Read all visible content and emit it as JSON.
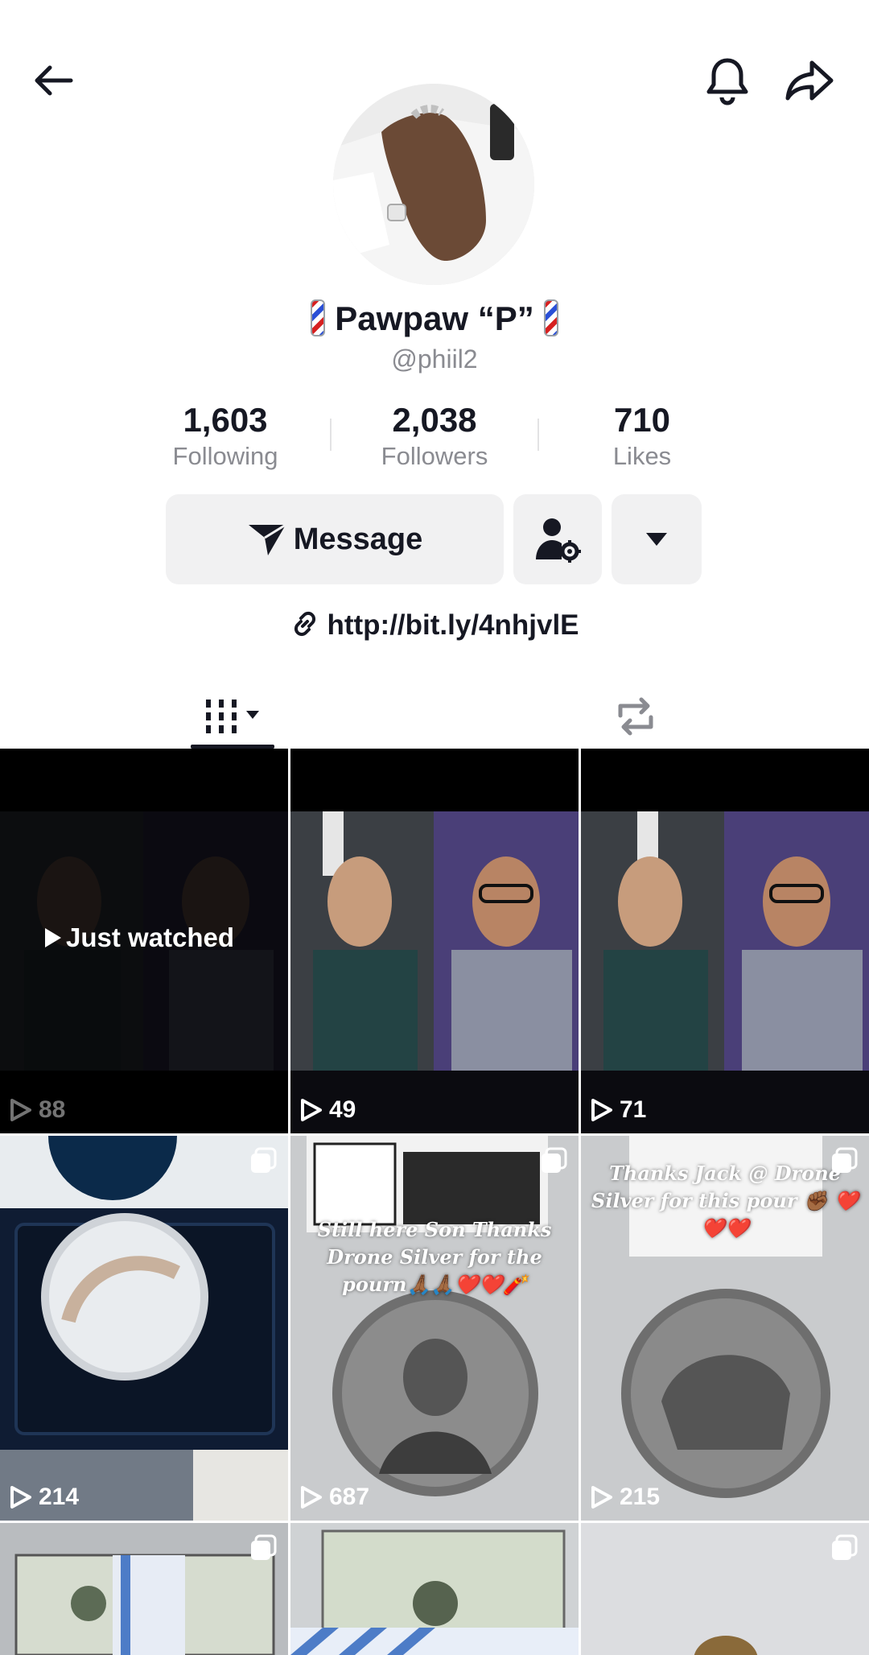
{
  "profile": {
    "display_name": "Pawpaw “P”",
    "handle": "@phiil2",
    "link": "http://bit.ly/4nhjvlE"
  },
  "stats": [
    {
      "value": "1,603",
      "label": "Following"
    },
    {
      "value": "2,038",
      "label": "Followers"
    },
    {
      "value": "710",
      "label": "Likes"
    }
  ],
  "actions": {
    "message_label": "Message"
  },
  "tabs": [
    {
      "icon": "videos-grid-icon",
      "active": true
    },
    {
      "icon": "repost-icon",
      "active": false
    }
  ],
  "videos": [
    {
      "views": "88",
      "overlay": "Just watched",
      "caption": ""
    },
    {
      "views": "49",
      "overlay": "",
      "caption": ""
    },
    {
      "views": "71",
      "overlay": "",
      "caption": ""
    },
    {
      "views": "214",
      "overlay": "",
      "caption": ""
    },
    {
      "views": "687",
      "overlay": "",
      "caption": "Still here Son Thanks Drone Silver for the pourn🙏🏾🙏🏾❤️❤️🧨"
    },
    {
      "views": "215",
      "overlay": "",
      "caption": "Thanks Jack @ Drone Silver for this pour ✊🏾 ❤️❤️❤️"
    }
  ],
  "colors": {
    "text_primary": "#161823",
    "text_secondary": "#8a8b91",
    "button_bg": "#f1f1f2"
  }
}
